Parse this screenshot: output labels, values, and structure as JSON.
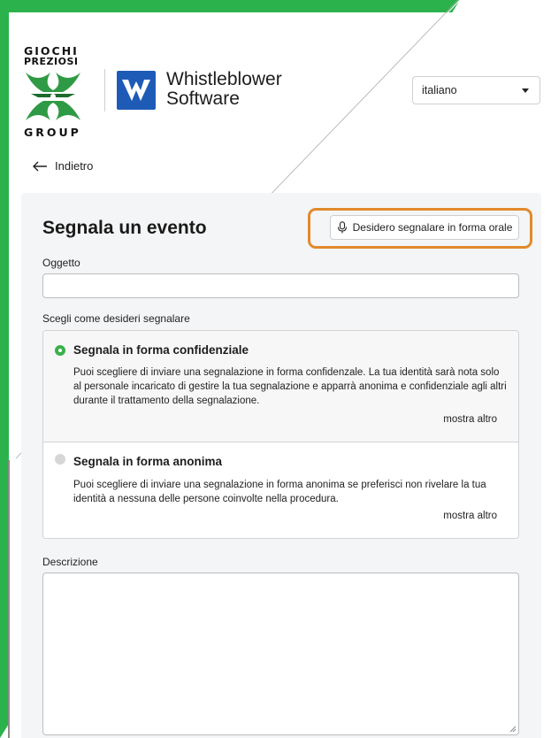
{
  "colors": {
    "brand_green": "#3bb14a",
    "highlight_orange": "#e18a2c",
    "wb_blue": "#1e5bb7"
  },
  "brand": {
    "gp_line1": "GIOCHI",
    "gp_line2": "PREZIOSI",
    "gp_line3": "GROUP",
    "wb_line1": "Whistleblower",
    "wb_line2": "Software"
  },
  "language": {
    "selected": "italiano"
  },
  "nav": {
    "back": "Indietro"
  },
  "form": {
    "title": "Segnala un evento",
    "oral_button": "Desidero segnalare in forma orale",
    "subject_label": "Oggetto",
    "subject_value": "",
    "choose_label": "Scegli come desideri segnalare",
    "options": [
      {
        "title": "Segnala in forma confidenziale",
        "selected": true,
        "desc": "Puoi scegliere di inviare una segnalazione in forma confidenzale. La tua identità sarà nota solo al personale incaricato di gestire la tua segnalazione e apparrà anonima e confidenziale agli altri durante il trattamento della segnalazione.",
        "more": "mostra altro"
      },
      {
        "title": "Segnala in forma anonima",
        "selected": false,
        "desc": "Puoi scegliere di inviare una segnalazione in forma anonima se preferisci non rivelare la tua identità a nessuna delle persone coinvolte nella procedura.",
        "more": "mostra altro"
      }
    ],
    "description_label": "Descrizione",
    "description_value": ""
  }
}
